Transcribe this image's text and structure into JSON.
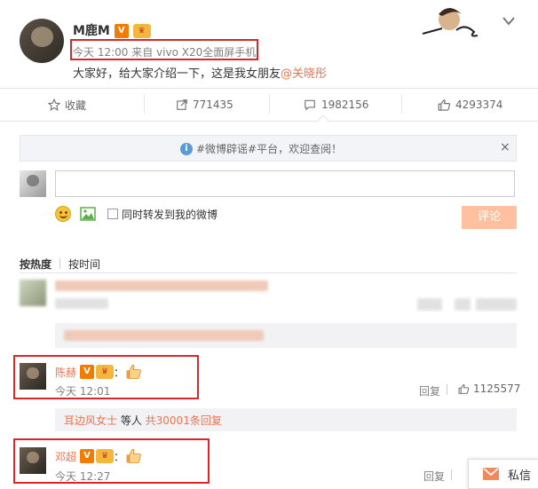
{
  "post": {
    "author": "M鹿M",
    "v_badge": "V",
    "source_line": "今天 12:00 来自 vivo X20全面屏手机",
    "text_prefix": "大家好，给大家介绍一下，这是我女朋友",
    "mention": "@关晓彤",
    "dropdown_icon": "chevron-down-icon"
  },
  "actions": {
    "favorite": "收藏",
    "repost_count": "771435",
    "comment_count": "1982156",
    "like_count": "4293374"
  },
  "notice": {
    "text": "#微博辟谣#平台，欢迎查阅！",
    "close": "×"
  },
  "compose": {
    "input_value": "",
    "checkbox_label": "同时转发到我的微博",
    "submit": "评论"
  },
  "sort_tabs": [
    "按热度",
    "按时间"
  ],
  "comments": [
    {
      "name": "陈赫",
      "suffix": "：",
      "time": "今天 12:01",
      "reply": "回复",
      "likes": "1125577",
      "sub_reply_user": "耳边风女士",
      "sub_reply_mid": " 等人 ",
      "sub_reply_total": "共30001条回复"
    },
    {
      "name": "邓超",
      "suffix": "：",
      "time": "今天 12:27",
      "reply": "回复"
    }
  ],
  "private_msg": "私信",
  "colors": {
    "accent": "#eb7350",
    "link": "#eb7350",
    "red_box": "#d9262b",
    "submit_bg": "#ffc09f"
  }
}
